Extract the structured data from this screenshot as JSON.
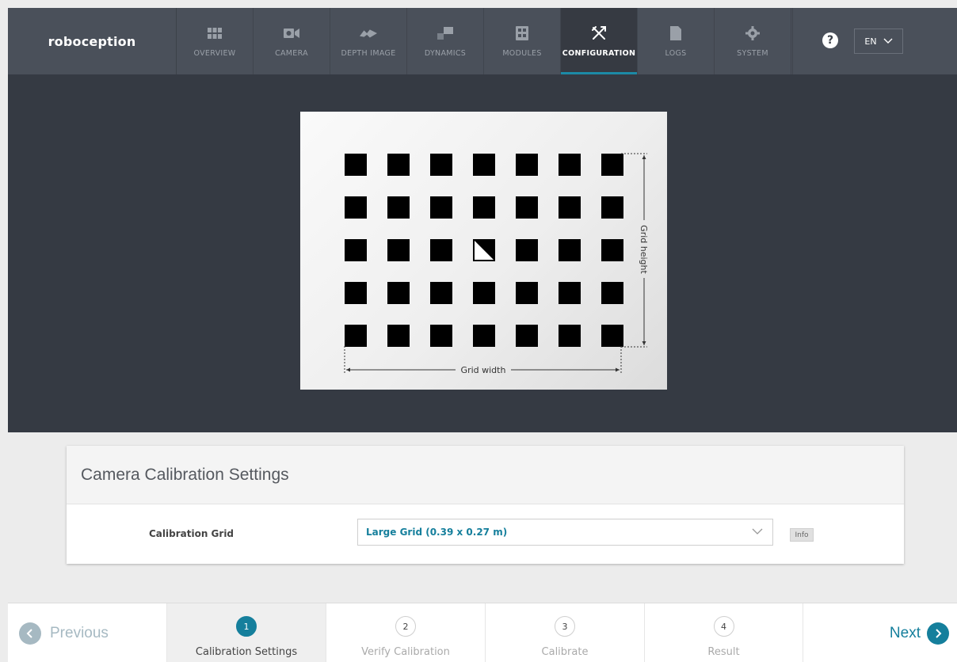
{
  "brand": "roboception",
  "nav": {
    "tabs": [
      {
        "label": "OVERVIEW",
        "icon": "grid-icon"
      },
      {
        "label": "CAMERA",
        "icon": "camera-icon"
      },
      {
        "label": "DEPTH IMAGE",
        "icon": "depth-image-icon"
      },
      {
        "label": "DYNAMICS",
        "icon": "dynamics-icon"
      },
      {
        "label": "MODULES",
        "icon": "modules-icon"
      },
      {
        "label": "CONFIGURATION",
        "icon": "tools-icon"
      },
      {
        "label": "LOGS",
        "icon": "logs-icon"
      },
      {
        "label": "SYSTEM",
        "icon": "gear-icon"
      }
    ],
    "active_tab": "CONFIGURATION",
    "help": "?",
    "language": "EN"
  },
  "calibration_board": {
    "grid_width_label": "Grid width",
    "grid_height_label": "Grid height",
    "rows": 5,
    "columns": 7
  },
  "settings": {
    "title": "Camera Calibration Settings",
    "grid_label": "Calibration Grid",
    "grid_value": "Large Grid (0.39 x 0.27 m)",
    "info_label": "Info"
  },
  "wizard": {
    "previous_label": "Previous",
    "next_label": "Next",
    "steps": [
      {
        "number": "1",
        "label": "Calibration Settings"
      },
      {
        "number": "2",
        "label": "Verify Calibration"
      },
      {
        "number": "3",
        "label": "Calibrate"
      },
      {
        "number": "4",
        "label": "Result"
      }
    ],
    "active_step": 1
  },
  "colors": {
    "accent": "#157f9c",
    "nav_bg": "#4a505a",
    "stage_bg": "#353a43"
  }
}
